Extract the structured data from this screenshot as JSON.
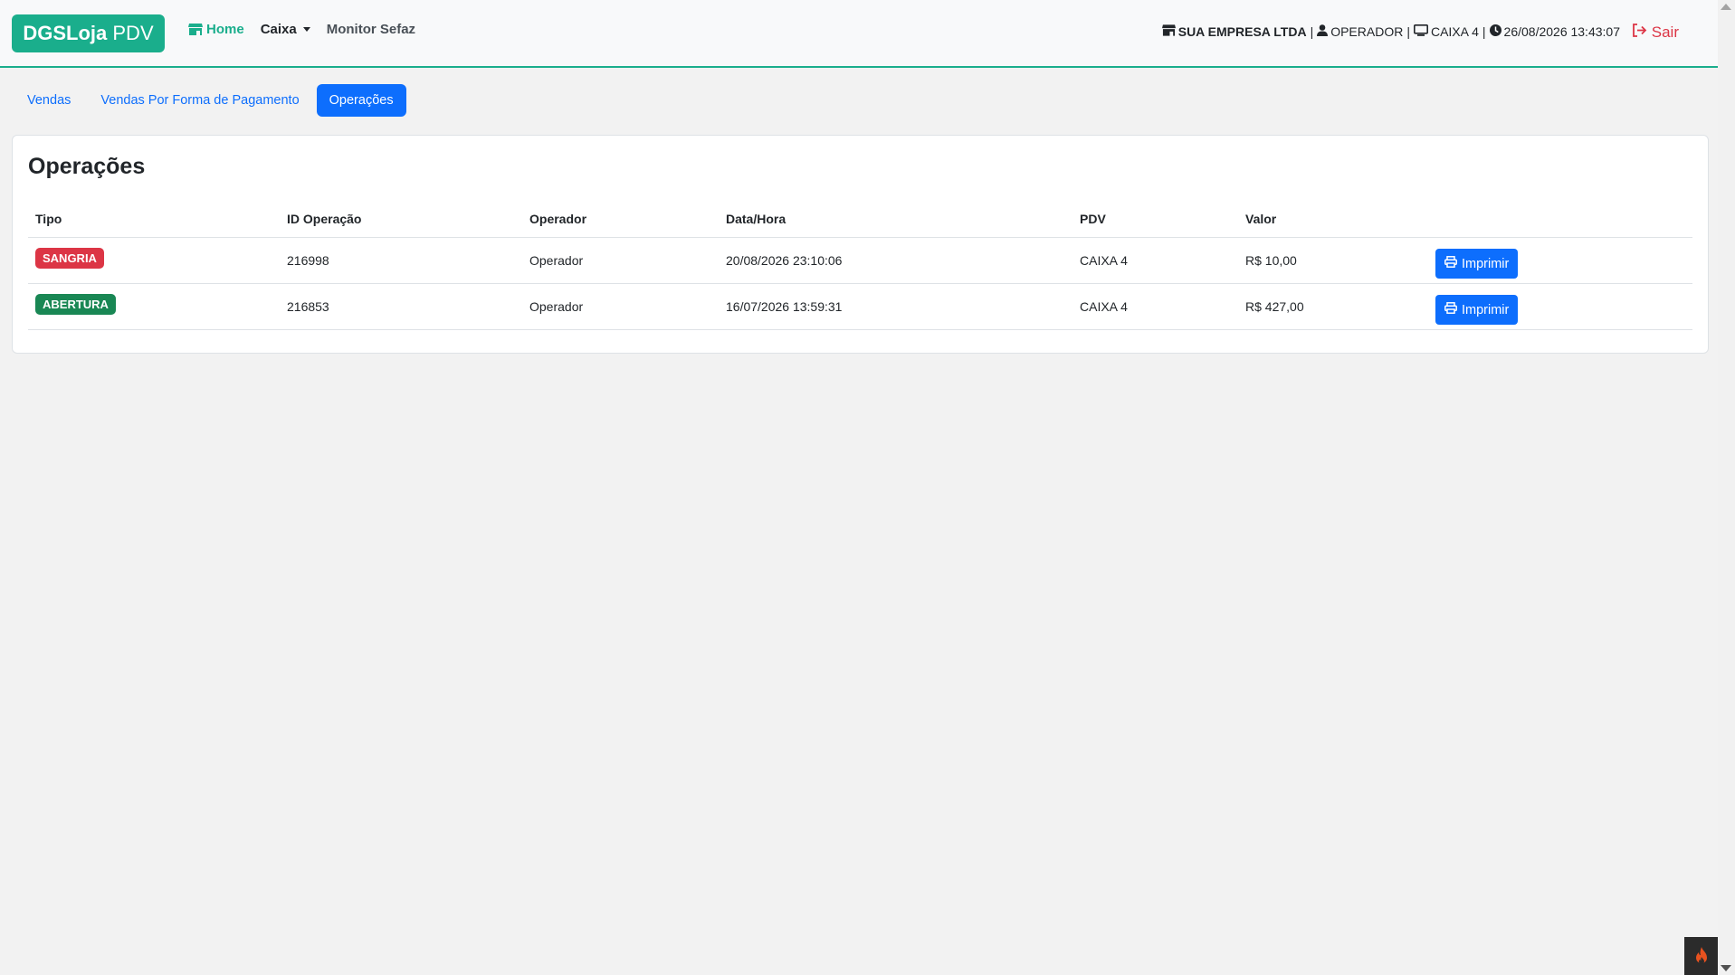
{
  "header": {
    "brand_bold": "DGSLoja",
    "brand_rest": " PDV",
    "nav": {
      "home": "Home",
      "caixa": "Caixa",
      "monitor": "Monitor Sefaz"
    },
    "company": "SUA EMPRESA LTDA",
    "operator": "OPERADOR",
    "pdv": "CAIXA 4",
    "datetime": "26/08/2026 13:43:07",
    "separator": "|",
    "logout": "Sair"
  },
  "tabs": [
    {
      "label": "Vendas"
    },
    {
      "label": "Vendas Por Forma de Pagamento"
    },
    {
      "label": "Operações"
    }
  ],
  "main": {
    "title": "Operações",
    "columns": [
      "Tipo",
      "ID Operação",
      "Operador",
      "Data/Hora",
      "PDV",
      "Valor"
    ],
    "rows": [
      {
        "tipo": "SANGRIA",
        "tipo_color": "#dc3545",
        "id": "216998",
        "operador": "Operador",
        "datahora": "20/08/2026 23:10:06",
        "pdv": "CAIXA 4",
        "valor": "R$ 10,00",
        "action": "Imprimir"
      },
      {
        "tipo": "ABERTURA",
        "tipo_color": "#198754",
        "id": "216853",
        "operador": "Operador",
        "datahora": "16/07/2026 13:59:31",
        "pdv": "CAIXA 4",
        "valor": "R$ 427,00",
        "action": "Imprimir"
      }
    ]
  },
  "colors": {
    "brand": "#1aae8c",
    "primary": "#0d6efd",
    "danger": "#dc3545",
    "success": "#198754"
  },
  "icons": {
    "store": "store-icon",
    "user": "user-icon",
    "monitor": "monitor-icon",
    "clock": "clock-icon",
    "logout": "sign-out-icon",
    "print": "print-icon",
    "corner": "flame-icon"
  }
}
